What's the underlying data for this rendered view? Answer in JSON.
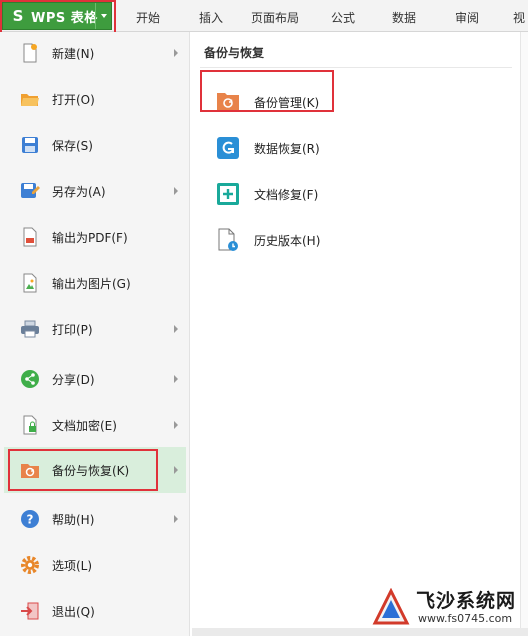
{
  "app": {
    "title": "WPS 表格",
    "logo_letter": "S",
    "accent": "#3e9c3e",
    "highlight_color": "#e0313a"
  },
  "ribbon": {
    "tabs": [
      "开始",
      "插入",
      "页面布局",
      "公式",
      "数据",
      "审阅",
      "视"
    ]
  },
  "menu": {
    "items": [
      {
        "label": "新建(N)",
        "icon": "new-file-icon",
        "submenu": true
      },
      {
        "label": "打开(O)",
        "icon": "open-folder-icon",
        "submenu": false
      },
      {
        "label": "保存(S)",
        "icon": "save-icon",
        "submenu": false
      },
      {
        "label": "另存为(A)",
        "icon": "save-as-icon",
        "submenu": true
      },
      {
        "label": "输出为PDF(F)",
        "icon": "pdf-icon",
        "submenu": false
      },
      {
        "label": "输出为图片(G)",
        "icon": "image-export-icon",
        "submenu": false
      },
      {
        "label": "打印(P)",
        "icon": "printer-icon",
        "submenu": true
      },
      {
        "label": "分享(D)",
        "icon": "share-icon",
        "submenu": true
      },
      {
        "label": "文档加密(E)",
        "icon": "encrypt-icon",
        "submenu": true
      },
      {
        "label": "备份与恢复(K)",
        "icon": "backup-icon",
        "submenu": true,
        "active": true
      },
      {
        "label": "帮助(H)",
        "icon": "help-icon",
        "submenu": true
      },
      {
        "label": "选项(L)",
        "icon": "options-gear-icon",
        "submenu": false
      },
      {
        "label": "退出(Q)",
        "icon": "exit-icon",
        "submenu": false
      }
    ]
  },
  "submenu": {
    "title": "备份与恢复",
    "items": [
      {
        "label": "备份管理(K)",
        "icon": "backup-manage-icon"
      },
      {
        "label": "数据恢复(R)",
        "icon": "data-recovery-icon"
      },
      {
        "label": "文档修复(F)",
        "icon": "doc-repair-icon"
      },
      {
        "label": "历史版本(H)",
        "icon": "history-version-icon"
      }
    ]
  },
  "watermark": {
    "name": "飞沙系统网",
    "url": "www.fs0745.com"
  }
}
